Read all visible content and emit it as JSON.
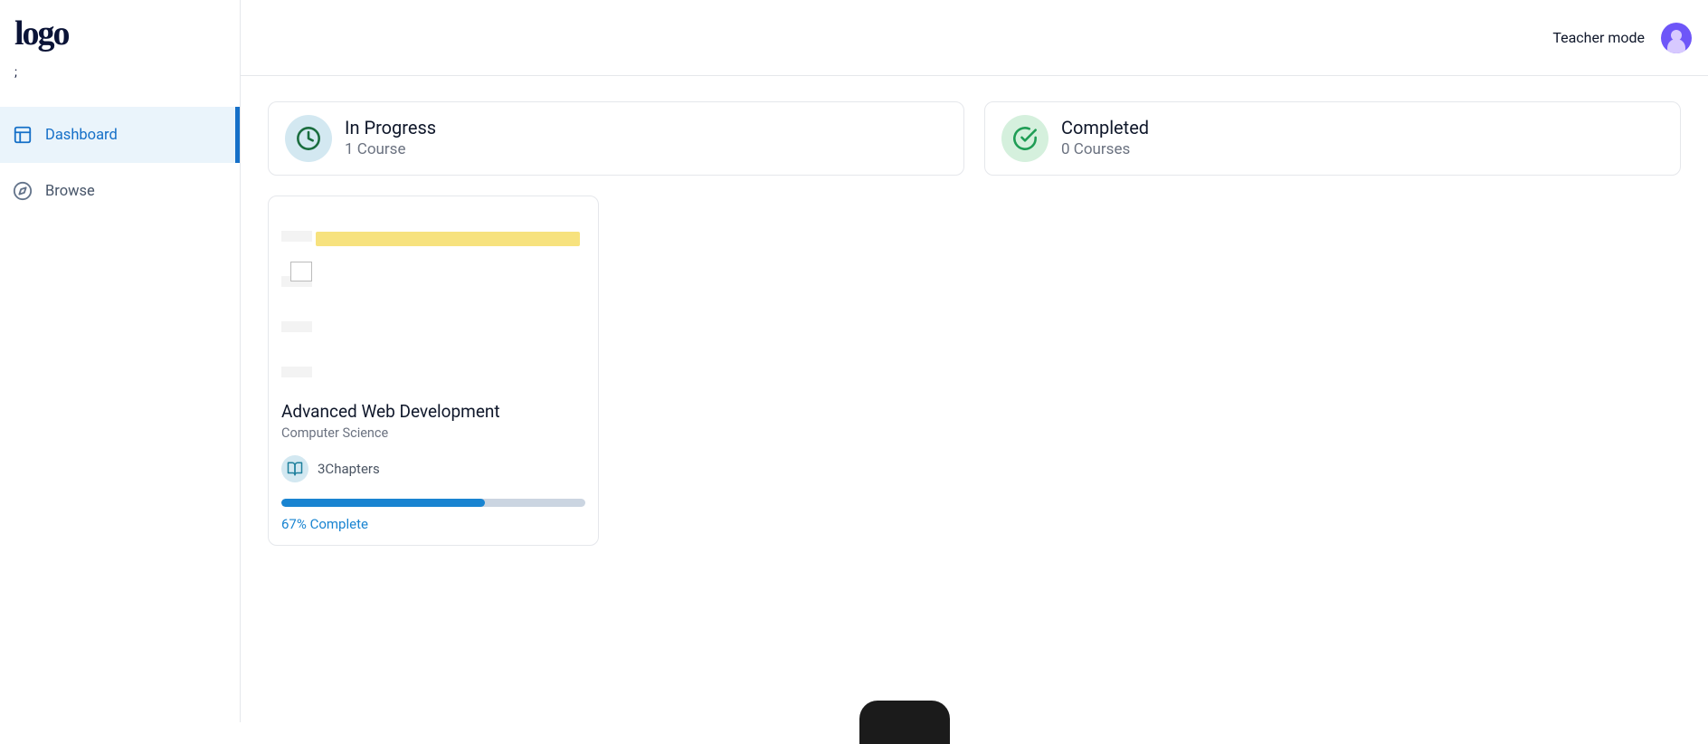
{
  "brand": {
    "logo_text": "logo",
    "logo_sub": ";"
  },
  "sidebar": {
    "items": [
      {
        "label": "Dashboard",
        "active": true
      },
      {
        "label": "Browse",
        "active": false
      }
    ]
  },
  "header": {
    "mode_link": "Teacher mode"
  },
  "stats": {
    "in_progress": {
      "title": "In Progress",
      "sub": "1 Course"
    },
    "completed": {
      "title": "Completed",
      "sub": "0 Courses"
    }
  },
  "courses": [
    {
      "title": "Advanced Web Development",
      "category": "Computer Science",
      "chapters_label": "3Chapters",
      "progress_pct": 67,
      "progress_label": "67% Complete"
    }
  ]
}
